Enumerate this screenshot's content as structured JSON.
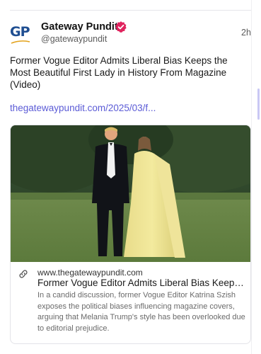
{
  "post": {
    "author_name": "Gateway Pundit",
    "handle": "@gatewaypundit",
    "time": "2h",
    "avatar_text": "GP",
    "verified_icon": "verified-badge-icon",
    "text": "Former Vogue Editor Admits Liberal Bias Keeps the Most Beautiful First Lady in History From Magazine (Video)",
    "link_text": "thegatewaypundit.com/2025/03/f..."
  },
  "card": {
    "domain": "www.thegatewaypundit.com",
    "title": "Former Vogue Editor Admits Liberal Bias Keeps the Most Beautiful First Lady in History From Magazine (Video)",
    "description": "In a candid discussion, former Vogue Editor Katrina Szish exposes the political biases influencing magazine covers, arguing that Melania Trump's style has been overlooked due to editorial prejudice.",
    "link_icon": "link-icon"
  },
  "colors": {
    "link": "#5b5bd6",
    "verified_badge": "#e0245e",
    "avatar": "#1f4e91"
  }
}
